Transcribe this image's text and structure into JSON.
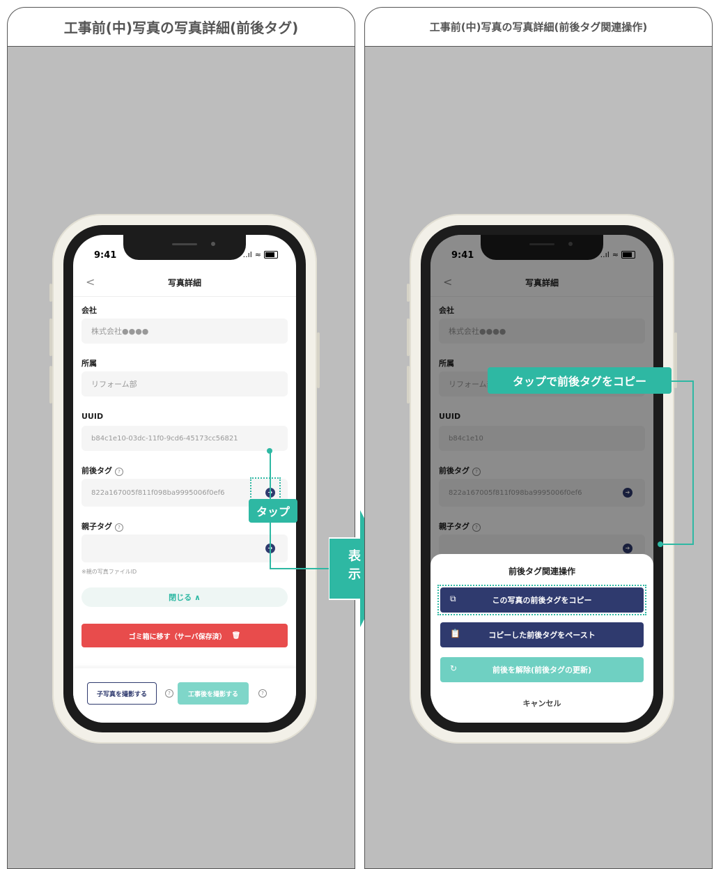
{
  "left_panel": {
    "title": "工事前(中)写真の写真詳細(前後タグ)",
    "phone": {
      "time": "9:41",
      "signal": "..ıl",
      "wifi": "≈",
      "nav_title": "写真詳細",
      "fields": [
        {
          "label": "会社",
          "value": "株式会社●●●●"
        },
        {
          "label": "所属",
          "value": "リフォーム部"
        },
        {
          "label": "UUID",
          "value": "b84c1e10-03dc-11f0-9cd6-45173cc56821"
        },
        {
          "label": "前後タグ",
          "value": "822a167005f811f098ba9995006f0ef6"
        },
        {
          "label": "親子タグ",
          "value": ""
        }
      ],
      "parent_note": "※親の写真ファイルID",
      "close_label": "閉じる ∧",
      "trash_label": "ゴミ箱に移す（サーバ保存済）",
      "child_photo_label": "子写真を撮影する",
      "after_photo_label": "工事後を撮影する",
      "help_mark": "?"
    },
    "tap_callout": "タップ"
  },
  "arrow_label": "表示",
  "right_panel": {
    "title": "工事前(中)写真の写真詳細(前後タグ関連操作)",
    "phone": {
      "time": "9:41",
      "nav_title": "写真詳細",
      "fields": [
        {
          "label": "会社",
          "value": "株式会社●●●●"
        },
        {
          "label": "所属",
          "value": "リフォーム部"
        },
        {
          "label": "UUID",
          "value": "b84c1e10"
        },
        {
          "label": "前後タグ",
          "value": "822a167005f811f098ba9995006f0ef6"
        },
        {
          "label": "親子タグ",
          "value": ""
        }
      ],
      "sheet": {
        "title": "前後タグ関連操作",
        "copy_label": "この写真の前後タグをコピー",
        "paste_label": "コピーした前後タグをペースト",
        "release_label": "前後を解除(前後タグの更新)",
        "cancel_label": "キャンセル"
      }
    },
    "copy_callout": "タップで前後タグをコピー"
  },
  "colors": {
    "teal": "#2eb8a3",
    "navy": "#2f3a6e",
    "red": "#e84c4c",
    "panel_bg": "#bdbdbd"
  }
}
